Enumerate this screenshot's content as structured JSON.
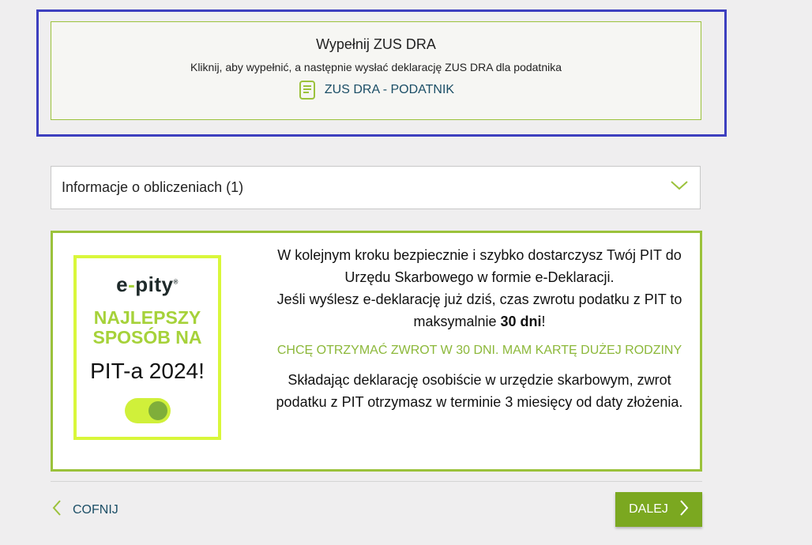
{
  "zus_card": {
    "title": "Wypełnij ZUS DRA",
    "subtitle": "Kliknij, aby wypełnić, a następnie wysłać deklarację ZUS DRA dla podatnika",
    "link_label": "ZUS DRA - PODATNIK",
    "link_icon": "document-icon"
  },
  "accordion": {
    "label": "Informacje o obliczeniach (1)",
    "icon": "chevron-down-icon"
  },
  "promo": {
    "banner": {
      "logo_text": "e",
      "logo_dash": "-",
      "logo_rest": "pity",
      "logo_mark": "®",
      "head_line1": "NAJLEPSZY",
      "head_line2": "SPOSÓB NA",
      "year_text": "PIT-a 2024!"
    },
    "text_line1": "W kolejnym kroku bezpiecznie i szybko dostarczysz Twój PIT do Urzędu Skarbowego w formie e-Deklaracji.",
    "text_line2_pre": "Jeśli wyślesz e-deklarację już dziś, czas zwrotu podatku z PIT to maksymalnie ",
    "text_line2_bold": "30 dni",
    "text_line2_post": "!",
    "cta": "CHCĘ OTRZYMAĆ ZWROT W 30 DNI. MAM KARTĘ DUŻEJ RODZINY",
    "tail": "Składając deklarację osobiście w urzędzie skarbowym, zwrot podatku z PIT otrzymasz w terminie 3 miesięcy od daty złożenia."
  },
  "nav": {
    "back_label": "COFNIJ",
    "next_label": "DALEJ"
  },
  "colors": {
    "accent_green": "#9bc23b",
    "button_green": "#7ba820",
    "link_blue": "#1b4e66",
    "highlight_frame": "#3d3fbf",
    "banner_lime": "#d9f73a"
  }
}
